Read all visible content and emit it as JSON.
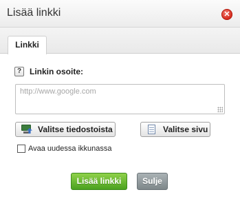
{
  "dialog": {
    "title": "Lisää linkki",
    "close_icon": "close-icon",
    "close_glyph": "✕"
  },
  "tabs": [
    {
      "label": "Linkki",
      "active": true
    }
  ],
  "link_form": {
    "help_icon": "help-icon",
    "help_glyph": "?",
    "url_label": "Linkin osoite:",
    "url_value": "",
    "url_placeholder": "http://www.google.com",
    "choose_file_label": "Valitse tiedostoista",
    "choose_file_icon": "computer-upload-icon",
    "choose_page_label": "Valitse sivu",
    "choose_page_icon": "document-icon",
    "new_window_label": "Avaa uudessa ikkunassa",
    "new_window_checked": false
  },
  "footer": {
    "submit_label": "Lisää linkki",
    "close_label": "Sulje"
  },
  "colors": {
    "primary_button": "#4aa21f",
    "secondary_button": "#7e878a",
    "close_icon": "#d62a1c"
  }
}
